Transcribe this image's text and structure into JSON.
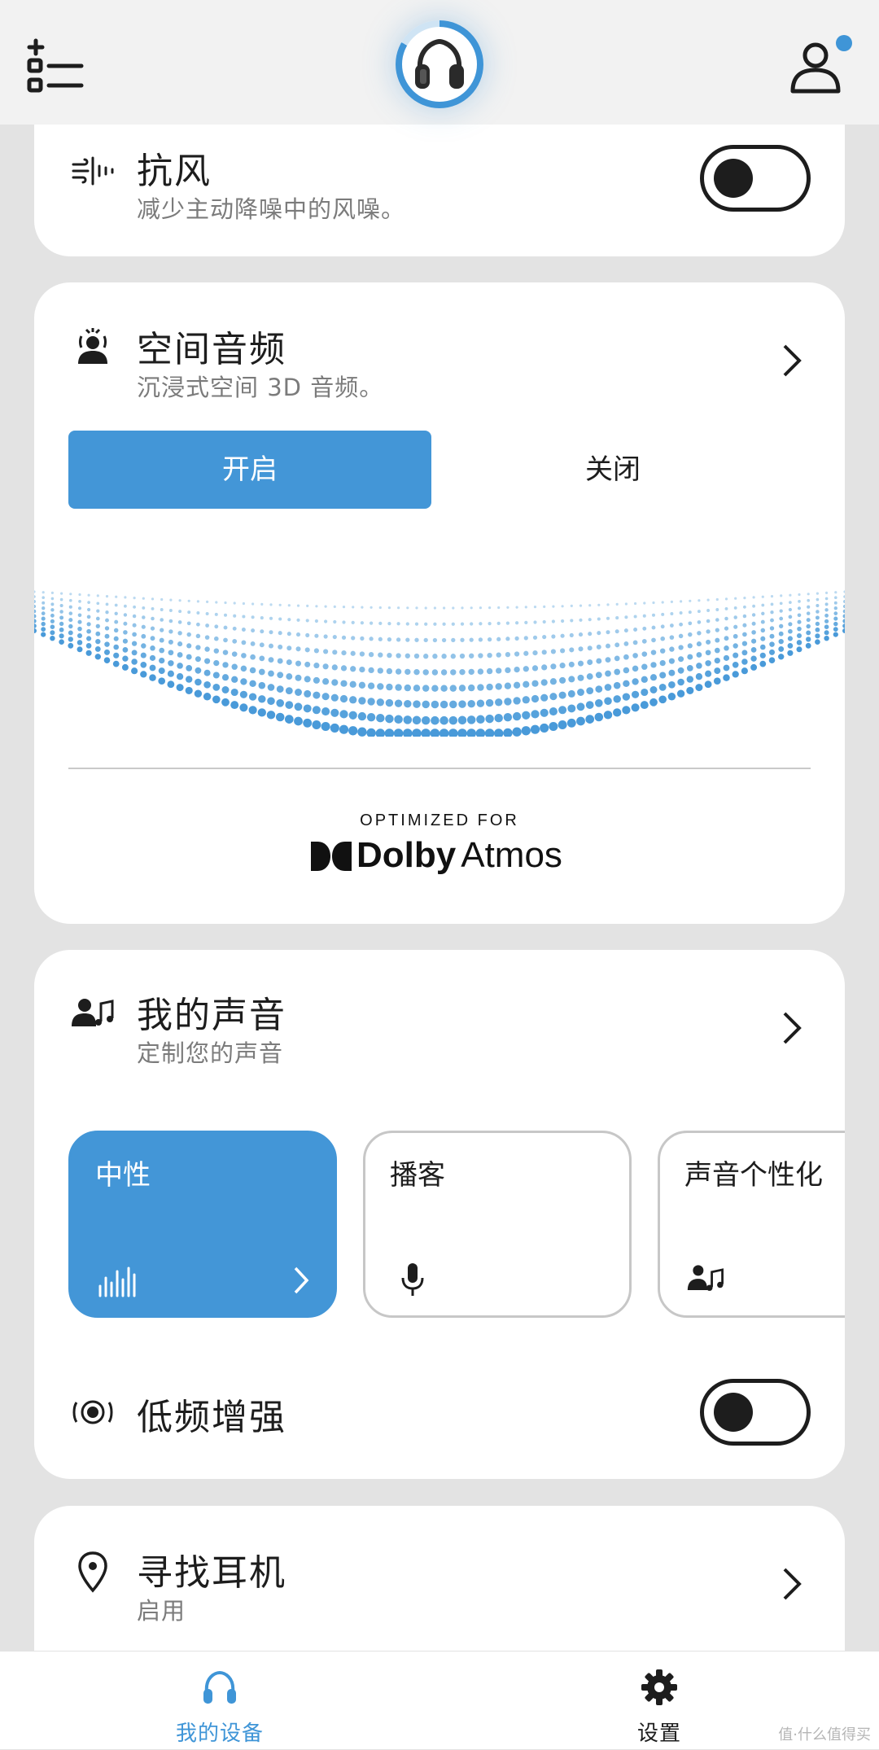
{
  "topbar": {
    "menu_icon": "add-list-icon",
    "device_icon": "headphones-icon",
    "profile_icon": "user-icon",
    "accent": "#3f95d7"
  },
  "wind": {
    "title": "抗风",
    "subtitle": "减少主动降噪中的风噪。",
    "toggle_on": false,
    "icon": "wind-icon"
  },
  "spatial": {
    "title": "空间音频",
    "subtitle": "沉浸式空间 3D 音频。",
    "on_label": "开启",
    "off_label": "关闭",
    "selected": "on",
    "dolby_caption": "OPTIMIZED FOR",
    "dolby_word_1": "Dolby",
    "dolby_word_2": "Atmos",
    "icon": "spatial-audio-icon"
  },
  "my_sound": {
    "title": "我的声音",
    "subtitle": "定制您的声音",
    "icon": "person-music-icon",
    "presets": [
      {
        "label": "中性",
        "icon": "equalizer-icon",
        "active": true
      },
      {
        "label": "播客",
        "icon": "microphone-icon",
        "active": false
      },
      {
        "label": "声音个性化",
        "icon": "person-music-icon",
        "active": false
      }
    ],
    "bass_title": "低频增强",
    "bass_toggle_on": false,
    "bass_icon": "bass-speaker-icon"
  },
  "find": {
    "title": "寻找耳机",
    "subtitle": "启用",
    "icon": "location-pin-icon"
  },
  "nav": {
    "items": [
      {
        "label": "我的设备",
        "icon": "headphones-icon",
        "active": true
      },
      {
        "label": "设置",
        "icon": "gear-icon",
        "active": false
      }
    ]
  },
  "watermark": "值·什么值得买"
}
